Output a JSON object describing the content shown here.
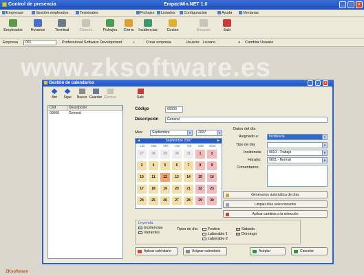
{
  "app": {
    "title": "Control de presencia",
    "product": "EmpacWin.NET 1.0",
    "window_buttons": [
      "_",
      "□",
      "×"
    ]
  },
  "menu": [
    "Empresas",
    "Gestión empleados",
    "Terminales",
    "Fichajes",
    "Listados",
    "Configuración",
    "Ayuda",
    "Ventanas"
  ],
  "toolbar": [
    {
      "label": "Empleados",
      "icon": "employees-icon",
      "disabled": false
    },
    {
      "label": "Horarios",
      "icon": "schedules-icon",
      "disabled": false
    },
    {
      "label": "Terminal",
      "icon": "terminal-icon",
      "disabled": false
    },
    {
      "label": "Calend.",
      "icon": "calendar-icon",
      "disabled": true
    },
    {
      "label": "Fichajes",
      "icon": "punches-icon",
      "disabled": false
    },
    {
      "label": "Cierre",
      "icon": "close-period-icon",
      "disabled": false
    },
    {
      "label": "Incidencias",
      "icon": "incidents-icon",
      "disabled": false
    },
    {
      "label": "Costes",
      "icon": "costs-icon",
      "disabled": false
    },
    {
      "label": "Bloqueo",
      "icon": "lock-icon",
      "disabled": true
    },
    {
      "label": "Salir",
      "icon": "exit-icon",
      "disabled": false
    }
  ],
  "status": {
    "empresa_label": "Empresa",
    "empresa_value": "001",
    "company_name": "Professional Software Development",
    "create_company": "Crear empresa",
    "user_label": "Usuario:",
    "user_value": "Lozano",
    "change_user": "Cambiar Usuario"
  },
  "watermark": "www.zksoftware.es",
  "logo": "ZKsoftware",
  "dialog": {
    "title": "Gestión de calendarios",
    "window_buttons": [
      "_",
      "□",
      "×"
    ],
    "toolbar": [
      {
        "label": "Ant",
        "icon": "previous-icon",
        "disabled": false
      },
      {
        "label": "Sigui",
        "icon": "next-icon",
        "disabled": false
      },
      {
        "label": "Nuevo",
        "icon": "new-icon",
        "disabled": false
      },
      {
        "label": "Guardar",
        "icon": "save-icon",
        "disabled": false
      },
      {
        "label": "Eliminar",
        "icon": "delete-icon",
        "disabled": true
      },
      {
        "label": "Salir",
        "icon": "exit-icon",
        "disabled": false
      }
    ],
    "list": {
      "headers": [
        "Cód",
        "Descripción"
      ],
      "rows": [
        {
          "code": "00000",
          "desc": "General"
        }
      ]
    },
    "form": {
      "codigo_label": "Código",
      "codigo_value": "00000",
      "descripcion_label": "Descripción",
      "descripcion_value": "General",
      "mes_label": "Mes:",
      "mes_value": "Septiembre",
      "year_value": "2007"
    },
    "calendar": {
      "header": "Septiembre 2007",
      "days_of_week": [
        "Lun",
        "Mar",
        "Mié",
        "Jue",
        "Vie",
        "Sáb",
        "Dom"
      ],
      "weeks": [
        [
          "27",
          "28",
          "29",
          "30",
          "31",
          "1",
          "2"
        ],
        [
          "3",
          "4",
          "5",
          "6",
          "7",
          "8",
          "9"
        ],
        [
          "10",
          "11",
          "12",
          "13",
          "14",
          "15",
          "16"
        ],
        [
          "17",
          "18",
          "19",
          "20",
          "21",
          "22",
          "23"
        ],
        [
          "24",
          "25",
          "26",
          "27",
          "28",
          "29",
          "30"
        ]
      ],
      "colors": {
        "weekday": "#f3e0a8",
        "weekend": "#f3bcbc",
        "outside": "#eeeeee",
        "selected": "#f5a070"
      }
    },
    "day_data": {
      "title": "Datos del día",
      "asignado_label": "Asignado a:",
      "asignado_value": "Incidencia",
      "tipo_label": "Tipo de día",
      "incidencia_label": "Incidencia:",
      "incidencia_value": "0010 - Trabajo",
      "horario_label": "Horario:",
      "horario_value": "0001 - Normal",
      "comentarios_label": "Comentarios:"
    },
    "actions": {
      "auto": "Generacion automática de días",
      "clear": "Limpiar días seleccionados",
      "apply": "Aplicar cambios a la selección"
    },
    "legend": {
      "title": "Leyenda",
      "incidencias": "Incidencias",
      "variantes": "Variantes",
      "tipos_label": "Tipos de día",
      "festivo": "Festivo",
      "laborable1": "Laborable 1",
      "laborable2": "Laborable 2",
      "sabado": "Sábado",
      "domingo": "Domingo"
    },
    "buttons": {
      "aplicar_calendario": "Aplicar calendario",
      "asignar_calendario": "Asignar calendario",
      "aceptar": "Aceptar",
      "cancelar": "Cancelar"
    }
  }
}
